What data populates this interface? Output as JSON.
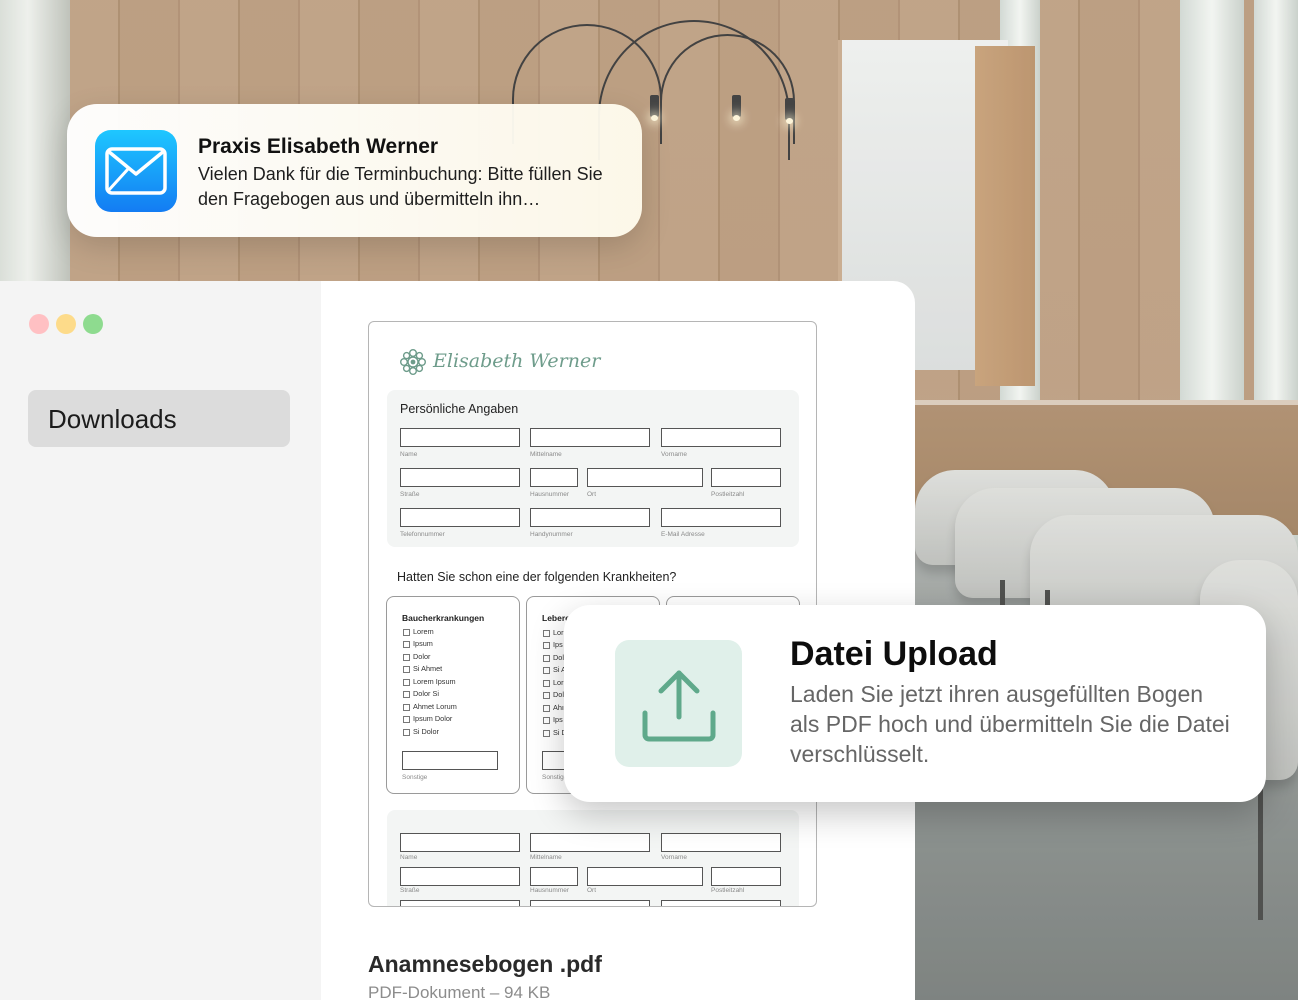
{
  "notification": {
    "sender": "Praxis Elisabeth Werner",
    "message": "Vielen Dank für die Terminbuchung: Bitte füllen Sie den Fragebogen aus und übermitteln ihn…",
    "app_icon": "mail-icon"
  },
  "sidebar": {
    "items": [
      {
        "label": "Downloads",
        "selected": true
      }
    ]
  },
  "document": {
    "brand": "Elisabeth Werner",
    "section_personal": "Persönliche Angaben",
    "labels": {
      "name": "Name",
      "middle_name": "Mittelname",
      "first_name": "Vorname",
      "street": "Straße",
      "house_number": "Hausnummer",
      "city": "Ort",
      "zip": "Postleitzahl",
      "phone": "Telefonnummer",
      "mobile": "Handynummer",
      "email": "E-Mail Adresse",
      "other": "Sonstige"
    },
    "question": "Hatten Sie schon eine der folgenden Krankheiten?",
    "card1": {
      "title": "Baucherkrankungen",
      "items": [
        "Lorem",
        "Ipsum",
        "Dolor",
        "Si Ahmet",
        "Lorem Ipsum",
        "Dolor Si",
        "Ahmet Lorum",
        "Ipsum Dolor",
        "Si Dolor"
      ]
    },
    "card2": {
      "title": "Leberer",
      "items": [
        "Lor",
        "Ips",
        "Dol",
        "Si A",
        "Lor",
        "Dol",
        "Ahı",
        "Ips",
        "Si D"
      ]
    }
  },
  "file": {
    "name": "Anamnesebogen .pdf",
    "meta": "PDF-Dokument – 94 KB"
  },
  "upload_card": {
    "title": "Datei Upload",
    "text": "Laden Sie jetzt ihren ausgefüllten Bogen als PDF hoch und übermitteln Sie die Datei verschlüsselt.",
    "icon": "upload-icon",
    "accent": "#5fa98b"
  },
  "colors": {
    "traffic_red": "#ffc0c3",
    "traffic_yellow": "#fddb8a",
    "traffic_green": "#8edb8f",
    "brand_green": "#6e9c8b"
  }
}
